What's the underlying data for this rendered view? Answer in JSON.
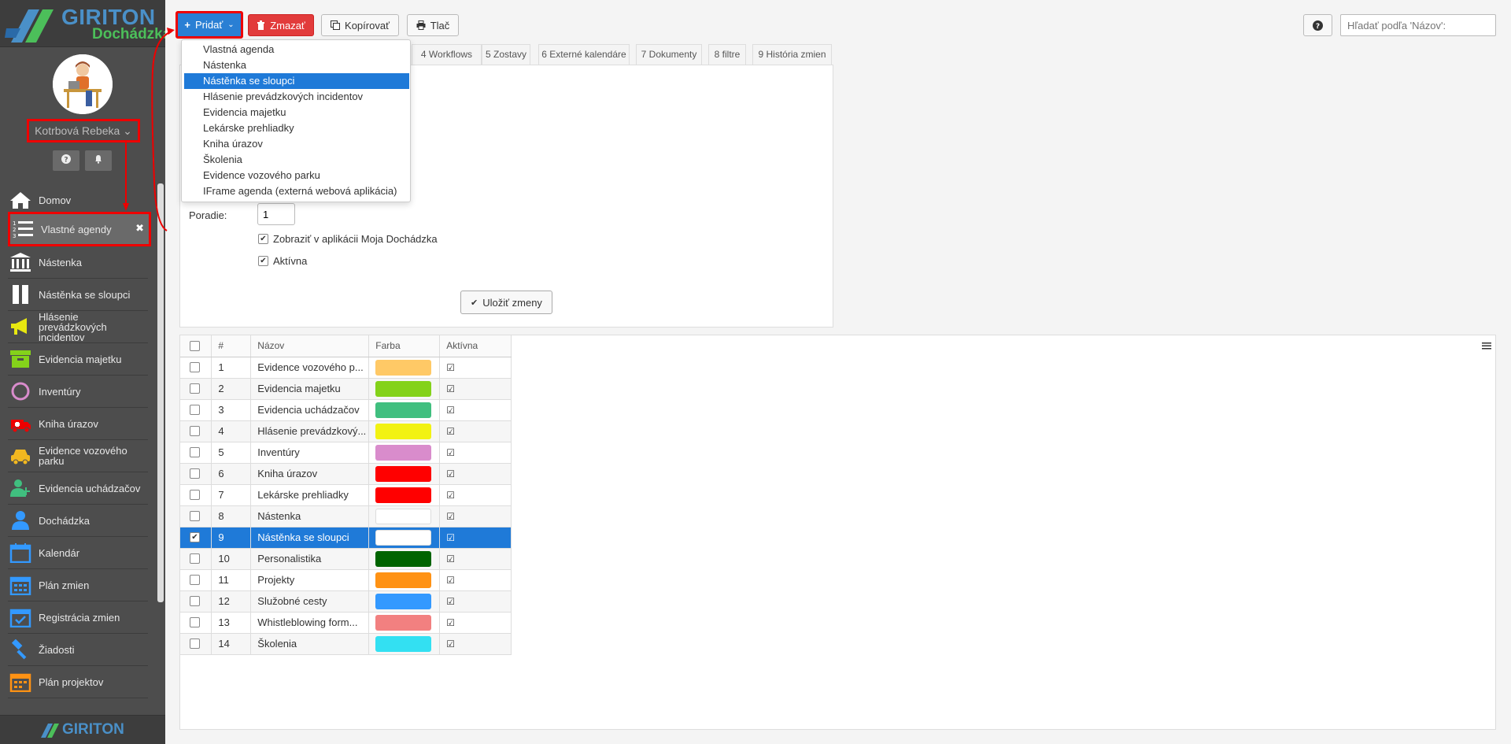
{
  "brand": {
    "name": "GIRITON",
    "product": "Dochádzka",
    "footer": "GIRITON"
  },
  "user": {
    "name": "Kotrbová Rebeka"
  },
  "sidebar": {
    "items": [
      {
        "label": "Domov",
        "icon": "home-icon"
      },
      {
        "label": "Vlastné agendy",
        "icon": "list-icon"
      },
      {
        "label": "Nástenka",
        "icon": "building-icon"
      },
      {
        "label": "Nástěnka se sloupci",
        "icon": "columns-icon"
      },
      {
        "label": "Hlásenie prevádzkových incidentov",
        "icon": "megaphone-icon"
      },
      {
        "label": "Evidencia majetku",
        "icon": "box-icon"
      },
      {
        "label": "Inventúry",
        "icon": "circle-icon"
      },
      {
        "label": "Kniha úrazov",
        "icon": "ambulance-icon"
      },
      {
        "label": "Evidence vozového parku",
        "icon": "car-icon"
      },
      {
        "label": "Evidencia uchádzačov",
        "icon": "user-add-icon"
      },
      {
        "label": "Dochádzka",
        "icon": "user-icon"
      },
      {
        "label": "Kalendár",
        "icon": "calendar-icon"
      },
      {
        "label": "Plán zmien",
        "icon": "calendar-grid-icon"
      },
      {
        "label": "Registrácia zmien",
        "icon": "calendar-check-icon"
      },
      {
        "label": "Žiadosti",
        "icon": "gavel-icon"
      },
      {
        "label": "Plán projektov",
        "icon": "calendar-orange-icon"
      }
    ]
  },
  "toolbar": {
    "add_label": "Pridať",
    "delete_label": "Zmazať",
    "copy_label": "Kopírovať",
    "print_label": "Tlač",
    "search_placeholder": "Hľadať podľa 'Názov':"
  },
  "tabs": [
    "4 Workflows",
    "5 Zostavy",
    "6 Externé kalendáre",
    "7 Dokumenty",
    "8 filtre",
    "9 História zmien"
  ],
  "dropdown": {
    "items": [
      "Vlastná agenda",
      "Nástenka",
      "Nástěnka se sloupci",
      "Hlásenie prevádzkových incidentov",
      "Evidencia majetku",
      "Lekárske prehliadky",
      "Kniha úrazov",
      "Školenia",
      "Evidence vozového parku",
      "IFrame agenda (externá webová aplikácia)"
    ],
    "selected": "Nástěnka se sloupci"
  },
  "form": {
    "order_label": "Poradie:",
    "order_value": "1",
    "show_in_app_label": "Zobraziť v aplikácii Moja Dochádzka",
    "active_label": "Aktívna",
    "save_label": "Uložiť zmeny"
  },
  "table": {
    "headers": [
      "#",
      "Názov",
      "Farba",
      "Aktívna"
    ],
    "rows": [
      {
        "num": "1",
        "name": "Evidence vozového p...",
        "color": "#ffc966",
        "active": true
      },
      {
        "num": "2",
        "name": "Evidencia majetku",
        "color": "#84d21a",
        "active": true
      },
      {
        "num": "3",
        "name": "Evidencia uchádzačov",
        "color": "#40bf7f",
        "active": true
      },
      {
        "num": "4",
        "name": "Hlásenie prevádzkový...",
        "color": "#f2f212",
        "active": true
      },
      {
        "num": "5",
        "name": "Inventúry",
        "color": "#d98ccc",
        "active": true
      },
      {
        "num": "6",
        "name": "Kniha úrazov",
        "color": "#ff0000",
        "active": true
      },
      {
        "num": "7",
        "name": "Lekárske prehliadky",
        "color": "#ff0000",
        "active": true
      },
      {
        "num": "8",
        "name": "Nástenka",
        "color": "#ffffff",
        "active": true
      },
      {
        "num": "9",
        "name": "Nástěnka se sloupci",
        "color": "#ffffff",
        "active": true,
        "selected": true
      },
      {
        "num": "10",
        "name": "Personalistika",
        "color": "#006400",
        "active": true
      },
      {
        "num": "11",
        "name": "Projekty",
        "color": "#ff9214",
        "active": true
      },
      {
        "num": "12",
        "name": "Služobné cesty",
        "color": "#3399ff",
        "active": true
      },
      {
        "num": "13",
        "name": "Whistleblowing form...",
        "color": "#f28080",
        "active": true
      },
      {
        "num": "14",
        "name": "Školenia",
        "color": "#33e0f2",
        "active": true
      }
    ]
  }
}
